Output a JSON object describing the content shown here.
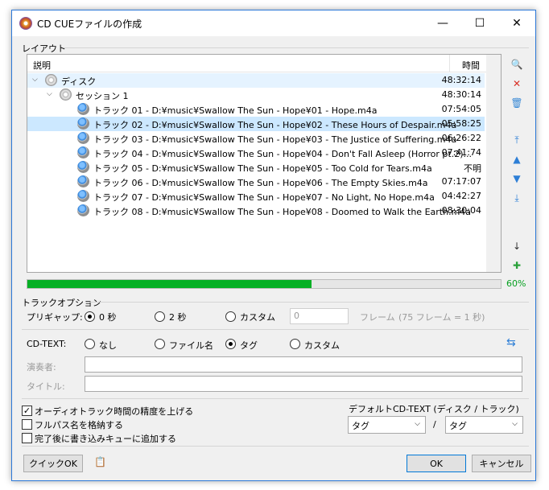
{
  "window": {
    "title": "CD CUEファイルの作成",
    "controls": [
      "—",
      "☐",
      "✕"
    ]
  },
  "layout_group": {
    "label": "レイアウト",
    "header": {
      "desc": "説明",
      "time": "時間"
    },
    "rows": [
      {
        "level": 0,
        "kind": "disc",
        "text": "ディスク",
        "time": "48:32:14",
        "state": "hl",
        "chevron": "⌵"
      },
      {
        "level": 1,
        "kind": "disc",
        "text": "セッション 1",
        "time": "48:30:14",
        "state": "",
        "chevron": "⌵"
      },
      {
        "level": 2,
        "kind": "track",
        "text": "トラック 01 - D:¥music¥Swallow The Sun - Hope¥01 - Hope.m4a",
        "time": "07:54:05",
        "state": ""
      },
      {
        "level": 2,
        "kind": "track",
        "text": "トラック 02 - D:¥music¥Swallow The Sun - Hope¥02 - These Hours of Despair.m4a",
        "time": "05:58:25",
        "state": "sel"
      },
      {
        "level": 2,
        "kind": "track",
        "text": "トラック 03 - D:¥music¥Swallow The Sun - Hope¥03 - The Justice of Suffering.m4a",
        "time": "06:26:22",
        "state": ""
      },
      {
        "level": 2,
        "kind": "track",
        "text": "トラック 04 - D:¥music¥Swallow The Sun - Hope¥04 - Don't Fall Asleep (Horror pt.2)...",
        "time": "07:41:74",
        "state": ""
      },
      {
        "level": 2,
        "kind": "track",
        "text": "トラック 05 - D:¥music¥Swallow The Sun - Hope¥05 - Too Cold for Tears.m4a",
        "time": "不明",
        "state": ""
      },
      {
        "level": 2,
        "kind": "track",
        "text": "トラック 06 - D:¥music¥Swallow The Sun - Hope¥06 - The Empty Skies.m4a",
        "time": "07:17:07",
        "state": ""
      },
      {
        "level": 2,
        "kind": "track",
        "text": "トラック 07 - D:¥music¥Swallow The Sun - Hope¥07 - No Light, No Hope.m4a",
        "time": "04:42:27",
        "state": ""
      },
      {
        "level": 2,
        "kind": "track",
        "text": "トラック 08 - D:¥music¥Swallow The Sun - Hope¥08 - Doomed to Walk the Earth.m4a",
        "time": "08:30:04",
        "state": ""
      }
    ],
    "side_icons": [
      "add-file-icon",
      "delete-icon",
      "clear-list-icon",
      "move-top-icon",
      "move-up-icon",
      "move-down-icon",
      "move-bottom-icon",
      "sort-icon",
      "add-disc-icon"
    ],
    "side_glyphs": [
      "🔍",
      "✕",
      "🗑",
      "⤒",
      "▲",
      "▼",
      "⤓",
      "↓",
      "✚"
    ],
    "progress": {
      "fraction": 0.6,
      "label": "60%"
    }
  },
  "track_options": {
    "label": "トラックオプション",
    "pregap": {
      "label": "プリギャップ:",
      "options": [
        "0 秒",
        "2 秒",
        "カスタム"
      ],
      "selected": 0,
      "custom_value": "0",
      "frame_label": "フレーム",
      "frame_hint": "(75 フレーム = 1 秒)"
    },
    "cdtext": {
      "label": "CD-TEXT:",
      "options": [
        "なし",
        "ファイル名",
        "タグ",
        "カスタム"
      ],
      "selected": 2,
      "refresh_glyph": "⇆"
    },
    "performer": {
      "label": "演奏者:",
      "value": ""
    },
    "title": {
      "label": "タイトル:",
      "value": ""
    }
  },
  "checkboxes": [
    {
      "label": "オーディオトラック時間の精度を上げる",
      "checked": true
    },
    {
      "label": "フルパス名を格納する",
      "checked": false
    },
    {
      "label": "完了後に書き込みキューに追加する",
      "checked": false
    }
  ],
  "default_cdtext": {
    "label": "デフォルトCD-TEXT (ディスク / トラック)",
    "disc": "タグ",
    "sep": "/",
    "track": "タグ",
    "arrow": "⌵"
  },
  "buttons": {
    "quick_ok": "クイックOK",
    "ok": "OK",
    "cancel": "キャンセル",
    "clipboard_glyph": "📋"
  },
  "colors": {
    "accent": "#0078d7",
    "selected_row": "#cce8ff",
    "progress_fill": "#06b025",
    "progress_text": "#06a020"
  }
}
